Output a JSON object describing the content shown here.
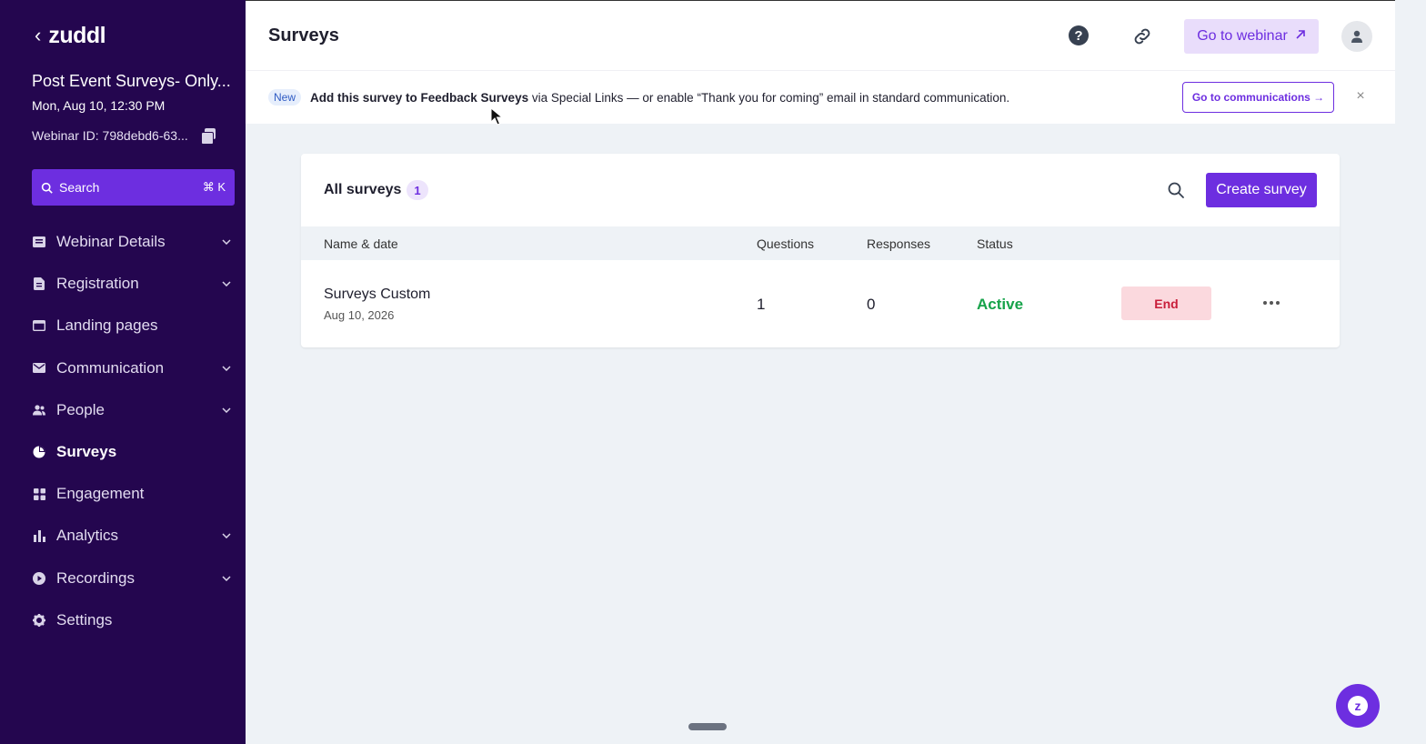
{
  "sidebar": {
    "logo": "zuddl",
    "event_title": "Post Event Surveys- Only...",
    "event_date": "Mon, Aug 10, 12:30 PM",
    "webinar_id": "Webinar ID: 798debd6-63...",
    "search_label": "Search",
    "search_shortcut": "⌘ K",
    "items": [
      {
        "label": "Webinar Details",
        "icon": "document-icon",
        "expandable": true
      },
      {
        "label": "Registration",
        "icon": "form-icon",
        "expandable": true
      },
      {
        "label": "Landing pages",
        "icon": "browser-icon",
        "expandable": false
      },
      {
        "label": "Communication",
        "icon": "mail-icon",
        "expandable": true
      },
      {
        "label": "People",
        "icon": "people-icon",
        "expandable": true
      },
      {
        "label": "Surveys",
        "icon": "pie-chart-icon",
        "expandable": false,
        "active": true
      },
      {
        "label": "Engagement",
        "icon": "grid-icon",
        "expandable": false
      },
      {
        "label": "Analytics",
        "icon": "bar-chart-icon",
        "expandable": true
      },
      {
        "label": "Recordings",
        "icon": "play-icon",
        "expandable": true
      },
      {
        "label": "Settings",
        "icon": "gear-icon",
        "expandable": false
      }
    ]
  },
  "header": {
    "title": "Surveys",
    "go_to_webinar": "Go to webinar"
  },
  "banner": {
    "badge": "New",
    "text_bold": "Add this survey to Feedback Surveys",
    "text_rest": " via Special Links — or enable “Thank you for coming” email in standard communication.",
    "action": "Go to communications →",
    "close": "×"
  },
  "surveys": {
    "title": "All surveys",
    "count": "1",
    "create_label": "Create survey",
    "columns": [
      "Name & date",
      "Questions",
      "Responses",
      "Status"
    ],
    "rows": [
      {
        "name": "Surveys Custom",
        "date": "Aug 10, 2026",
        "questions": "1",
        "responses": "0",
        "status": "Active",
        "action": "End"
      }
    ]
  },
  "colors": {
    "sidebar_bg": "#24064f",
    "accent": "#6d2ee0",
    "active_status": "#16a34a",
    "end_bg": "#fbd9de",
    "end_text": "#c81e3a"
  }
}
